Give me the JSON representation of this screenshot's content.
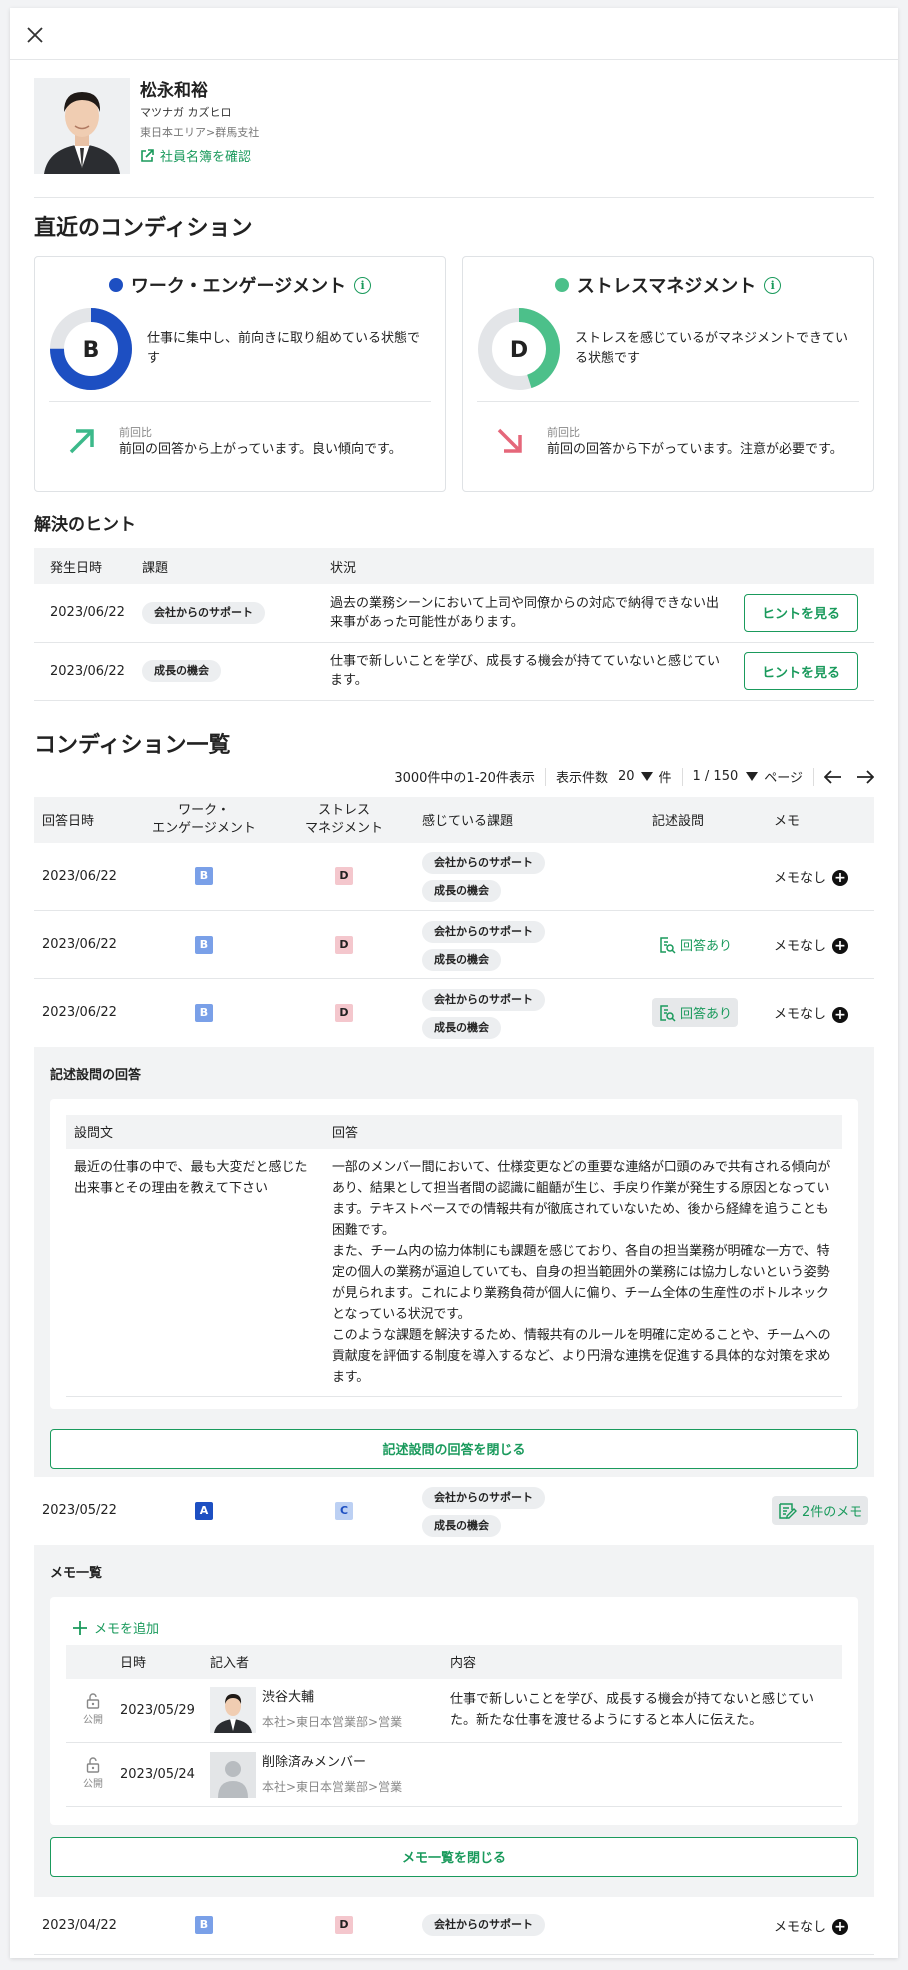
{
  "profile": {
    "name": "松永和裕",
    "kana": "マツナガ カズヒロ",
    "area": "東日本エリア>群馬支社",
    "link": "社員名簿を確認"
  },
  "condition": {
    "title": "直近のコンディション",
    "cards": [
      {
        "title": "ワーク・エンゲージメント",
        "color": "#1d4fc2",
        "grade": "B",
        "fill": 0.75,
        "desc": "仕事に集中し、前向きに取り組めている状態です",
        "trend_label": "前回比",
        "trend_text": "前回の回答から上がっています。良い傾向です。",
        "trend": "up",
        "trend_color": "#3cb98a"
      },
      {
        "title": "ストレスマネジメント",
        "color": "#4cc08a",
        "grade": "D",
        "fill": 0.45,
        "desc": "ストレスを感じているがマネジメントできている状態です",
        "trend_label": "前回比",
        "trend_text": "前回の回答から下がっています。注意が必要です。",
        "trend": "down",
        "trend_color": "#e5677a"
      }
    ]
  },
  "hints": {
    "title": "解決のヒント",
    "headers": [
      "発生日時",
      "課題",
      "状況"
    ],
    "rows": [
      {
        "date": "2023/06/22",
        "chip": "会社からのサポート",
        "text": "過去の業務シーンにおいて上司や同僚からの対応で納得できない出来事があった可能性があります。",
        "btn": "ヒントを見る"
      },
      {
        "date": "2023/06/22",
        "chip": "成長の機会",
        "text": "仕事で新しいことを学び、成長する機会が持てていないと感じています。",
        "btn": "ヒントを見る"
      }
    ]
  },
  "list": {
    "title": "コンディション一覧",
    "count_text": "3000件中の1-20件表示",
    "per_page_label": "表示件数",
    "per_page": "20",
    "per_page_unit": "件",
    "page": "1 / 150",
    "page_unit": "ページ",
    "headers": {
      "date": "回答日時",
      "work": "ワーク・\nエンゲージメント",
      "stress": "ストレス\nマネジメント",
      "issues": "感じている課題",
      "free": "記述設問",
      "memo": "メモ"
    },
    "rows": [
      {
        "date": "2023/06/22",
        "work": "B",
        "stress": "D",
        "chips": [
          "会社からのサポート",
          "成長の機会"
        ],
        "free": "",
        "memo": "メモなし"
      },
      {
        "date": "2023/06/22",
        "work": "B",
        "stress": "D",
        "chips": [
          "会社からのサポート",
          "成長の機会"
        ],
        "free": "回答あり",
        "memo": "メモなし"
      },
      {
        "date": "2023/06/22",
        "work": "B",
        "stress": "D",
        "chips": [
          "会社からのサポート",
          "成長の機会"
        ],
        "free": "回答あり",
        "memo": "メモなし"
      }
    ],
    "answer": {
      "title": "記述設問の回答",
      "h_q": "設問文",
      "h_a": "回答",
      "question": "最近の仕事の中で、最も大変だと感じた出来事とその理由を教えて下さい",
      "answer": "一部のメンバー間において、仕様変更などの重要な連絡が口頭のみで共有される傾向があり、結果として担当者間の認識に齟齬が生じ、手戻り作業が発生する原因となっています。テキストベースでの情報共有が徹底されていないため、後から経緯を追うことも困難です。\nまた、チーム内の協力体制にも課題を感じており、各自の担当業務が明確な一方で、特定の個人の業務が逼迫していても、自身の担当範囲外の業務には協力しないという姿勢が見られます。これにより業務負荷が個人に偏り、チーム全体の生産性のボトルネックとなっている状況です。\nこのような課題を解決するため、情報共有のルールを明確に定めることや、チームへの貢献度を評価する制度を導入するなど、より円滑な連携を促進する具体的な対策を求めます。",
      "close": "記述設問の回答を閉じる"
    },
    "row4": {
      "date": "2023/05/22",
      "work": "A",
      "stress": "C",
      "chips": [
        "会社からのサポート",
        "成長の機会"
      ],
      "memo_btn": "2件のメモ"
    },
    "memos": {
      "title": "メモ一覧",
      "add": "メモを追加",
      "h_date": "日時",
      "h_author": "記入者",
      "h_content": "内容",
      "items": [
        {
          "lock": "公開",
          "date": "2023/05/29",
          "name": "渋谷大輔",
          "org": "本社>東日本営業部>営業",
          "content": "仕事で新しいことを学び、成長する機会が持てないと感じていた。新たな仕事を渡せるようにすると本人に伝えた。"
        },
        {
          "lock": "公開",
          "date": "2023/05/24",
          "name": "削除済みメンバー",
          "org": "本社>東日本営業部>営業",
          "content": ""
        }
      ],
      "close": "メモ一覧を閉じる"
    },
    "row5": {
      "date": "2023/04/22",
      "work": "B",
      "stress": "D",
      "chips": [
        "会社からのサポート"
      ],
      "memo": "メモなし"
    }
  }
}
